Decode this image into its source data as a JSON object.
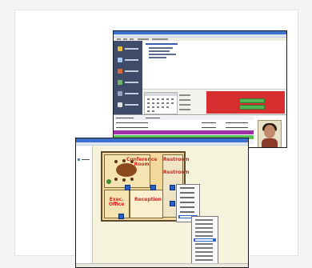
{
  "floor_plan": {
    "rooms": {
      "conference": [
        "Conference",
        "Room"
      ],
      "restroom": [
        "Restroom",
        "Restroom"
      ],
      "office": [
        "Exec.",
        "Office"
      ],
      "reception": "Reception"
    }
  },
  "colors": {
    "alert_red": "#d72f2f",
    "status_green": "#52b552",
    "event_purple": "#a12fa6",
    "plan_label_red": "#e02020",
    "sidebar_navy": "#3e4c69"
  },
  "icons": [
    "user-photo-icon",
    "device-icon",
    "tree-folder-icon",
    "plant-icon",
    "conference-table-icon"
  ]
}
